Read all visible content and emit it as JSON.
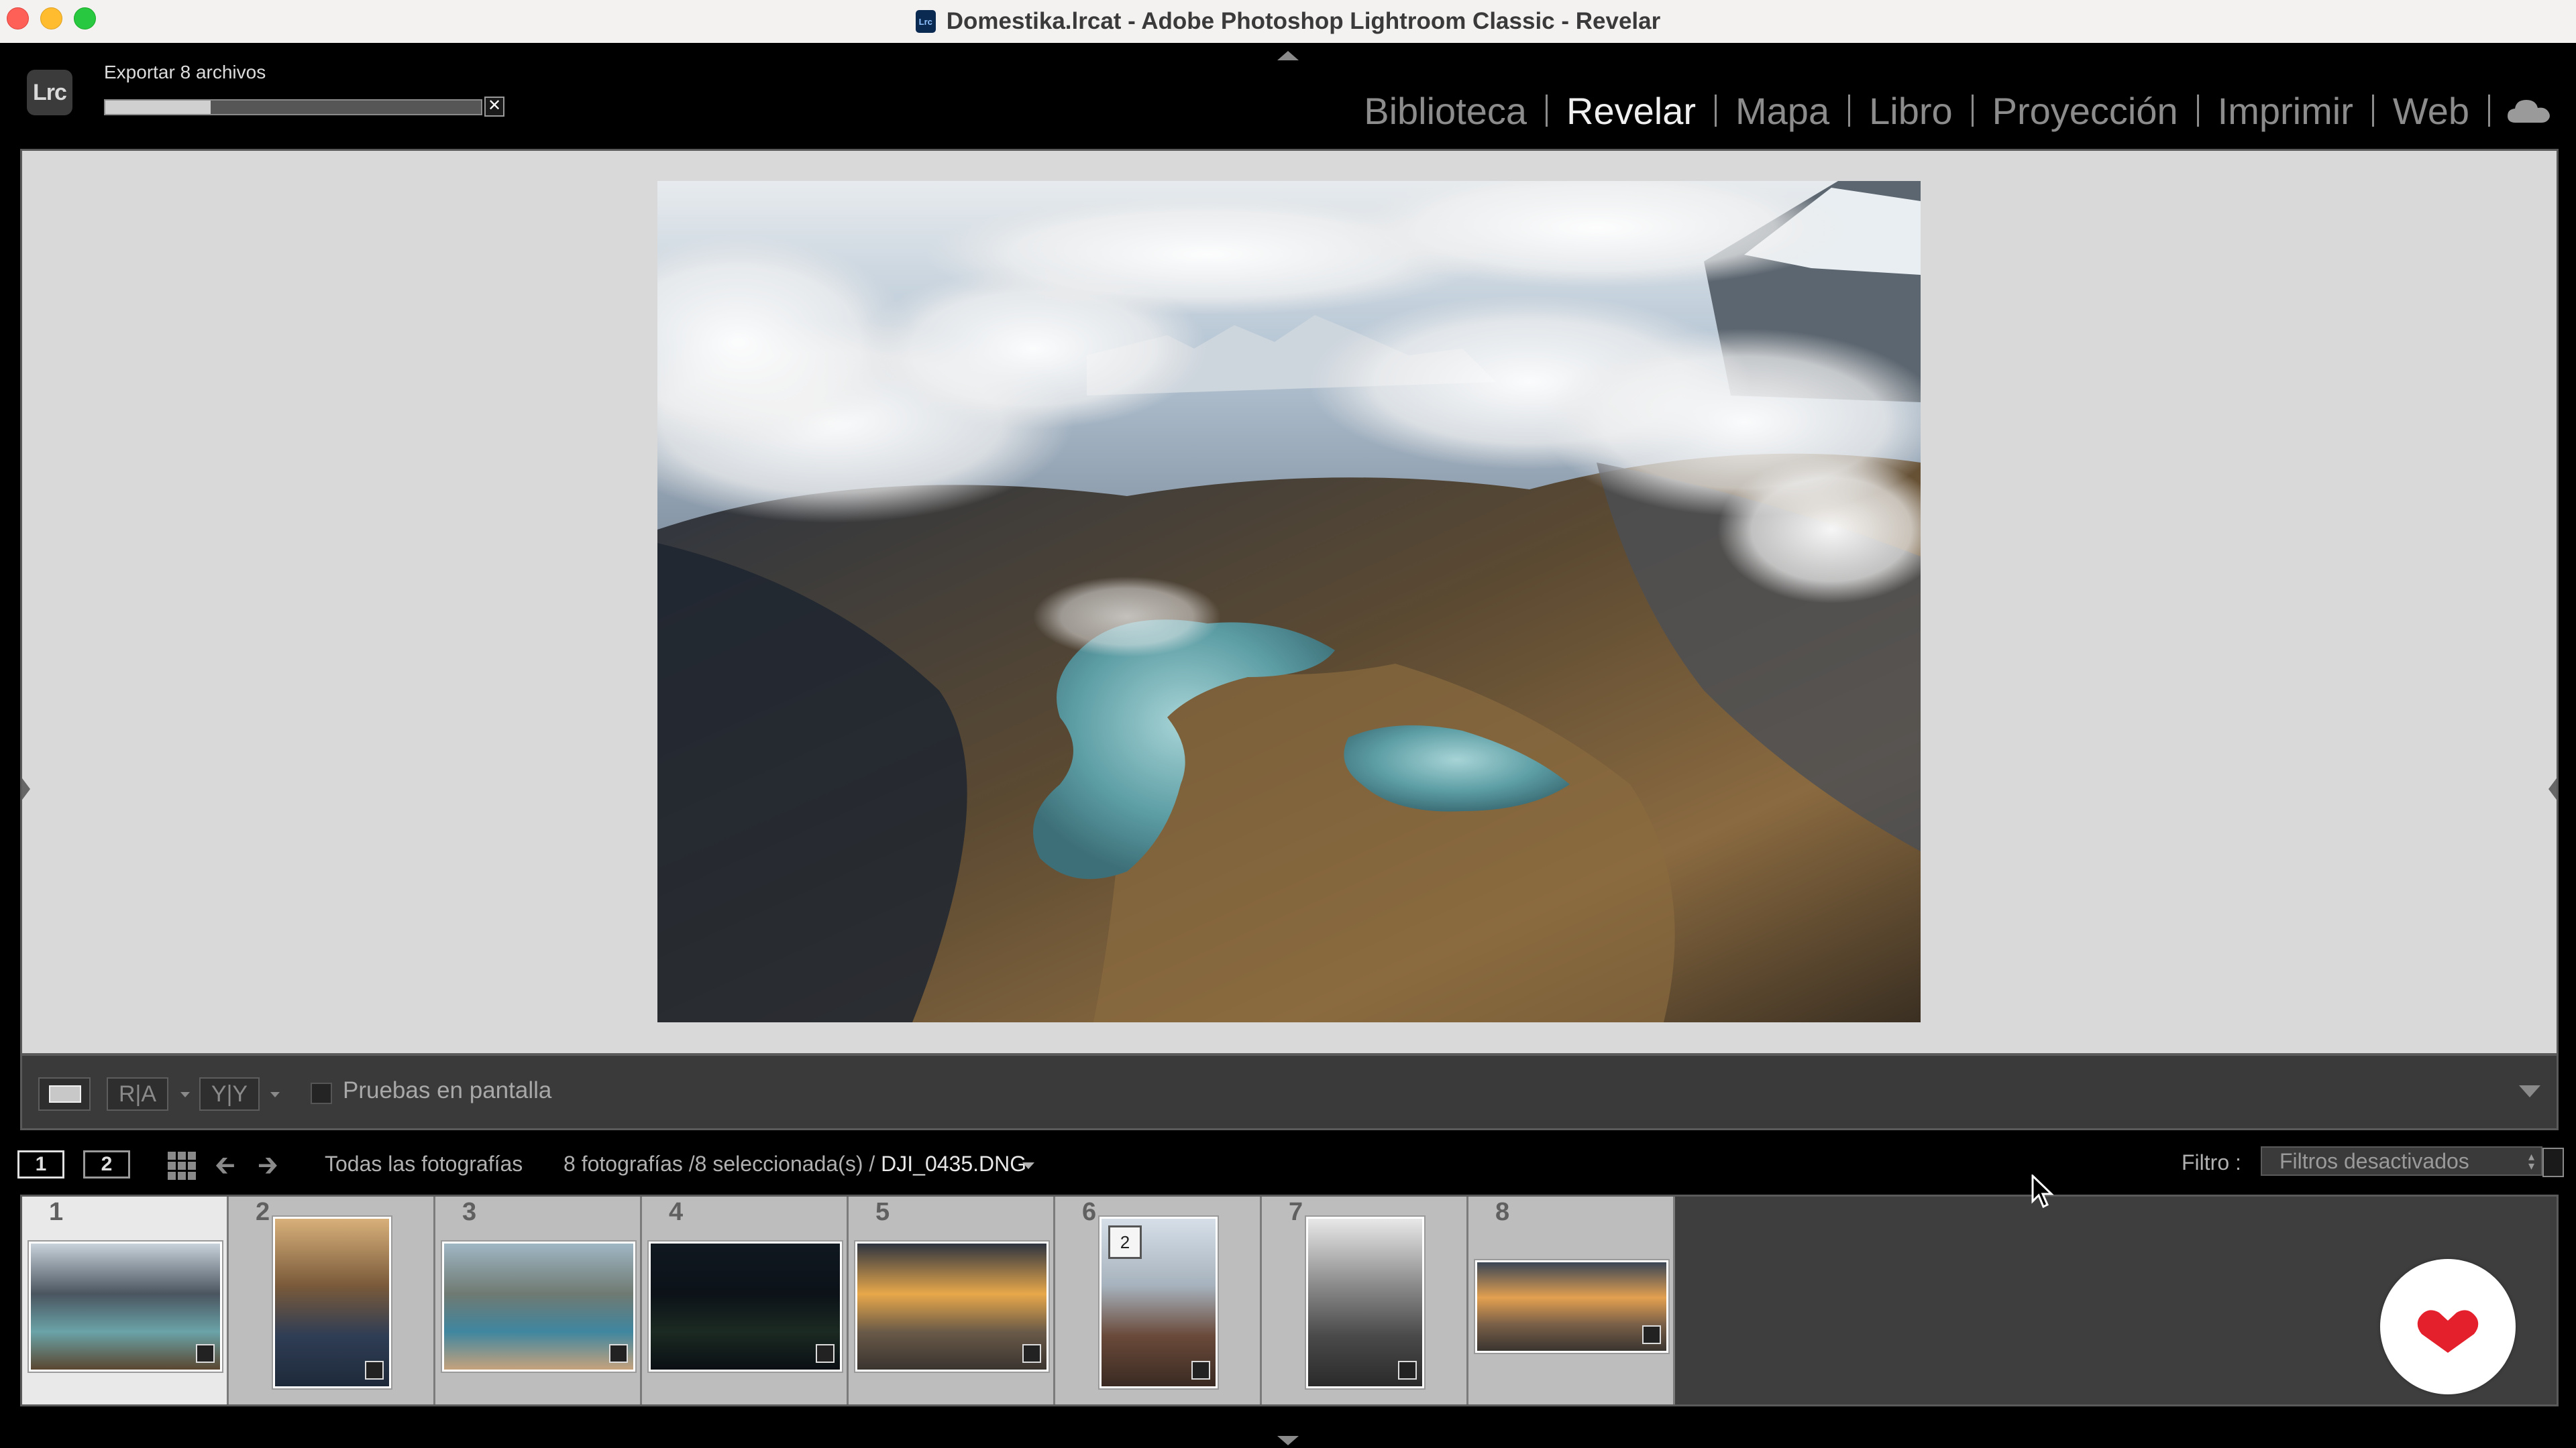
{
  "window": {
    "title": "Domestika.lrcat - Adobe Photoshop Lightroom Classic - Revelar",
    "app_icon_text": "Lrc"
  },
  "top_panel": {
    "badge": "Lrc",
    "export_label": "Exportar 8 archivos",
    "export_progress": 0.28,
    "cancel_symbol": "✕"
  },
  "modules": [
    {
      "label": "Biblioteca",
      "active": false
    },
    {
      "label": "Revelar",
      "active": true
    },
    {
      "label": "Mapa",
      "active": false
    },
    {
      "label": "Libro",
      "active": false
    },
    {
      "label": "Proyección",
      "active": false
    },
    {
      "label": "Imprimir",
      "active": false
    },
    {
      "label": "Web",
      "active": false
    }
  ],
  "toolbar": {
    "ra_label": "R|A",
    "yy_label": "Y|Y",
    "soft_proof_label": "Pruebas en pantalla"
  },
  "filmstrip_header": {
    "screen1": "1",
    "screen2": "2",
    "source": "Todas las fotografías",
    "count": "8 fotografías /8 seleccionada(s) /",
    "file": "DJI_0435.DNG",
    "filter_label": "Filtro :",
    "filter_value": "Filtros desactivados"
  },
  "thumbnails": [
    {
      "index": "1",
      "stack": "",
      "colors": [
        "#c8d2da",
        "#4a5560",
        "#6aa3a8",
        "#5a4630"
      ]
    },
    {
      "index": "2",
      "stack": "",
      "colors": [
        "#d8b07a",
        "#7a5a3a",
        "#2f3d55",
        "#1e2a3a"
      ]
    },
    {
      "index": "3",
      "stack": "",
      "colors": [
        "#9fb6c4",
        "#6f7a72",
        "#3f86a0",
        "#c6a27c"
      ]
    },
    {
      "index": "4",
      "stack": "",
      "colors": [
        "#101820",
        "#0c1218",
        "#1b2a22",
        "#0a0f14"
      ]
    },
    {
      "index": "5",
      "stack": "",
      "colors": [
        "#2e3440",
        "#e8a84a",
        "#6a5a48",
        "#3a3430"
      ]
    },
    {
      "index": "6",
      "stack": "2",
      "colors": [
        "#d6dfe8",
        "#a6b2bd",
        "#6a4a3a",
        "#3a2a22"
      ]
    },
    {
      "index": "7",
      "stack": "",
      "colors": [
        "#e8e8e8",
        "#8a8a8a",
        "#4a4a4a",
        "#2a2a2a"
      ]
    },
    {
      "index": "8",
      "stack": "",
      "colors": [
        "#3a4656",
        "#e3a050",
        "#7a6048",
        "#3a3530"
      ]
    }
  ],
  "colors": {
    "accent_active": "#f0f0f0",
    "module_inactive": "#8c8c8c",
    "domestika_red": "#e4202c"
  },
  "icons": [
    "lightroom-app-icon",
    "cloud-icon",
    "grid-icon",
    "prev-arrow-icon",
    "next-arrow-icon",
    "domestika-logo-icon",
    "mouse-cursor-icon"
  ]
}
